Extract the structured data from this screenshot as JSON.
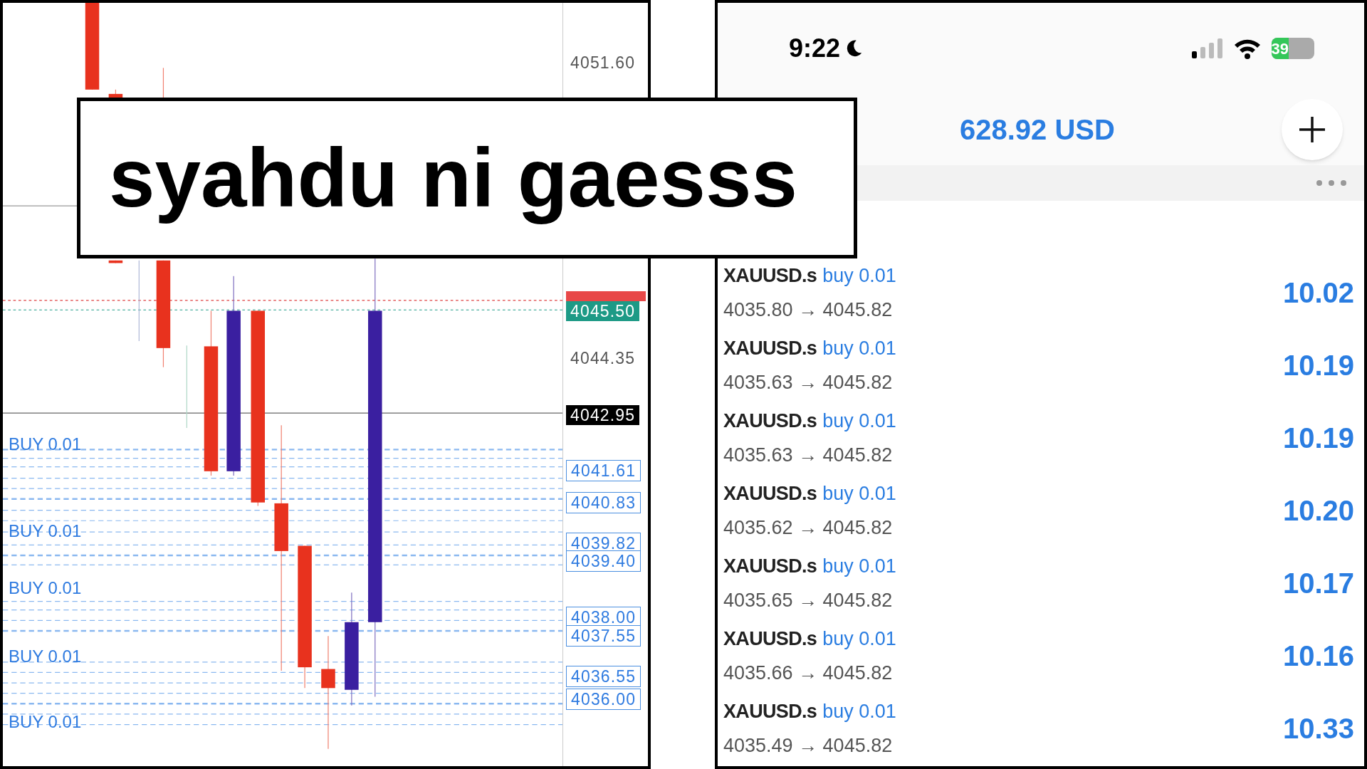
{
  "chart": {
    "price_labels": [
      {
        "text": "4051.60",
        "kind": "plain"
      },
      {
        "text": "4045.50",
        "kind": "bid"
      },
      {
        "text": "4044.35",
        "kind": "plain"
      },
      {
        "text": "4042.95",
        "kind": "current"
      },
      {
        "text": "4041.61",
        "kind": "order"
      },
      {
        "text": "4040.83",
        "kind": "order"
      },
      {
        "text": "4039.82",
        "kind": "order"
      },
      {
        "text": "4039.40",
        "kind": "order"
      },
      {
        "text": "4038.00",
        "kind": "order"
      },
      {
        "text": "4037.55",
        "kind": "order"
      },
      {
        "text": "4036.55",
        "kind": "order"
      },
      {
        "text": "4036.00",
        "kind": "order"
      }
    ],
    "order_labels": [
      "BUY 0.01",
      "BUY 0.01",
      "BUY 0.01",
      "BUY 0.01",
      "BUY 0.01"
    ]
  },
  "caption": "syahdu ni gaesss",
  "account": {
    "time": "9:22",
    "battery": "39",
    "balance": "628.92 USD",
    "positions": [
      {
        "symbol": "XAUUSD.s",
        "side": "buy 0.01",
        "prices": "4035.80 → 4045.82",
        "profit": "10.02"
      },
      {
        "symbol": "XAUUSD.s",
        "side": "buy 0.01",
        "prices": "4035.63 → 4045.82",
        "profit": "10.19"
      },
      {
        "symbol": "XAUUSD.s",
        "side": "buy 0.01",
        "prices": "4035.63 → 4045.82",
        "profit": "10.19"
      },
      {
        "symbol": "XAUUSD.s",
        "side": "buy 0.01",
        "prices": "4035.62 → 4045.82",
        "profit": "10.20"
      },
      {
        "symbol": "XAUUSD.s",
        "side": "buy 0.01",
        "prices": "4035.65 → 4045.82",
        "profit": "10.17"
      },
      {
        "symbol": "XAUUSD.s",
        "side": "buy 0.01",
        "prices": "4035.66 → 4045.82",
        "profit": "10.16"
      },
      {
        "symbol": "XAUUSD.s",
        "side": "buy 0.01",
        "prices": "4035.49 → 4045.82",
        "profit": "10.33"
      }
    ]
  }
}
